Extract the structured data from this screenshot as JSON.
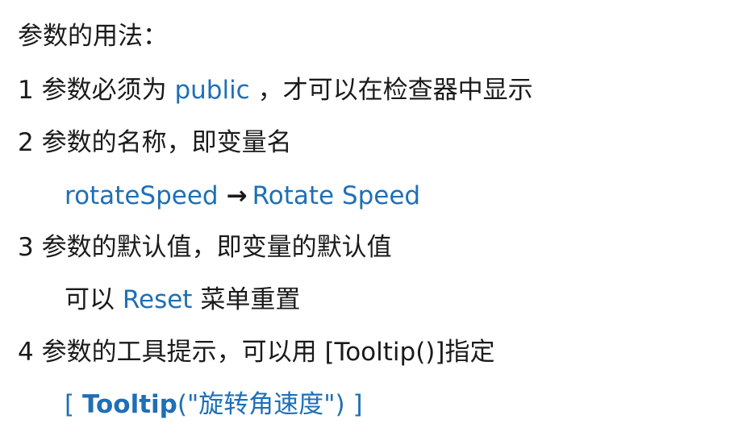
{
  "title": "参数的用法：",
  "item1": {
    "num": "1",
    "text_a": "参数必须为",
    "keyword": "public",
    "text_b": "，才可以在检查器中显示"
  },
  "item2": {
    "num": "2",
    "text": "参数的名称，即变量名",
    "example_var": "rotateSpeed",
    "arrow": "→",
    "example_label": "Rotate Speed"
  },
  "item3": {
    "num": "3",
    "text": "参数的默认值，即变量的默认值",
    "sub_a": "可以",
    "sub_keyword": "Reset",
    "sub_b": "菜单重置"
  },
  "item4": {
    "num": "4",
    "text": "参数的工具提示，可以用",
    "attr": "[Tooltip()]",
    "text_b": "指定",
    "code_open": "[",
    "code_name": "Tooltip",
    "code_args": "(\"旋转角速度\")",
    "code_close": "]"
  },
  "colors": {
    "text": "#1a1a1a",
    "accent": "#1f6fb6",
    "background": "#ffffff"
  }
}
